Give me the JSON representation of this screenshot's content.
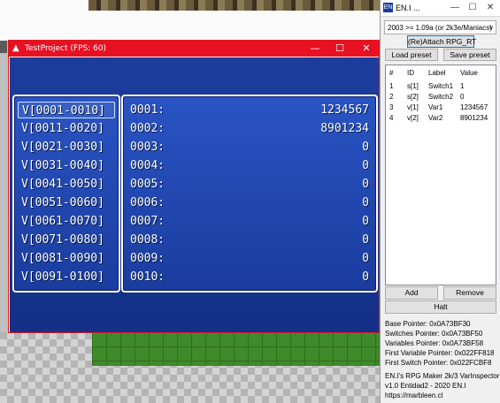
{
  "game_window": {
    "title": "TestProject (FPS: 60)",
    "controls": {
      "minimize": "—",
      "maximize": "☐",
      "close": "✕"
    },
    "ranges": [
      "V[0001-0010]",
      "V[0011-0020]",
      "V[0021-0030]",
      "V[0031-0040]",
      "V[0041-0050]",
      "V[0051-0060]",
      "V[0061-0070]",
      "V[0071-0080]",
      "V[0081-0090]",
      "V[0091-0100]"
    ],
    "variables": [
      {
        "id": "0001:",
        "value": "1234567"
      },
      {
        "id": "0002:",
        "value": "8901234"
      },
      {
        "id": "0003:",
        "value": "0"
      },
      {
        "id": "0004:",
        "value": "0"
      },
      {
        "id": "0005:",
        "value": "0"
      },
      {
        "id": "0006:",
        "value": "0"
      },
      {
        "id": "0007:",
        "value": "0"
      },
      {
        "id": "0008:",
        "value": "0"
      },
      {
        "id": "0009:",
        "value": "0"
      },
      {
        "id": "0010:",
        "value": "0"
      }
    ]
  },
  "inspector": {
    "title": "EN.I ...",
    "controls": {
      "minimize": "—",
      "maximize": "☐",
      "close": "✕"
    },
    "version_select": "2003 >= 1.09a (or 2k3e/Maniacs)",
    "attach_button": "(Re)Attach RPG_RT",
    "load_preset_button": "Load preset",
    "save_preset_button": "Save preset",
    "columns": [
      "#",
      "ID",
      "Label",
      "Value"
    ],
    "rows": [
      {
        "num": "1",
        "id": "s[1]",
        "label": "Switch1",
        "value": "1"
      },
      {
        "num": "2",
        "id": "s[2]",
        "label": "Switch2",
        "value": "0"
      },
      {
        "num": "3",
        "id": "v[1]",
        "label": "Var1",
        "value": "1234567"
      },
      {
        "num": "4",
        "id": "v[2]",
        "label": "Var2",
        "value": "8901234"
      }
    ],
    "add_button": "Add",
    "remove_button": "Remove",
    "halt_button": "Halt",
    "pointers": [
      "Base Pointer: 0x0A73BF30",
      "Switches Pointer: 0x0A73BF50",
      "Variables Pointer: 0x0A73BF58",
      "First Variable Pointer: 0x022FF818",
      "First Switch Pointer: 0x022FCBF8"
    ],
    "about": [
      "EN.I's RPG Maker 2k/3 VarInspector",
      "v1.0 Entidad2 - 2020 EN.I",
      "https://marbleen.cl"
    ]
  }
}
